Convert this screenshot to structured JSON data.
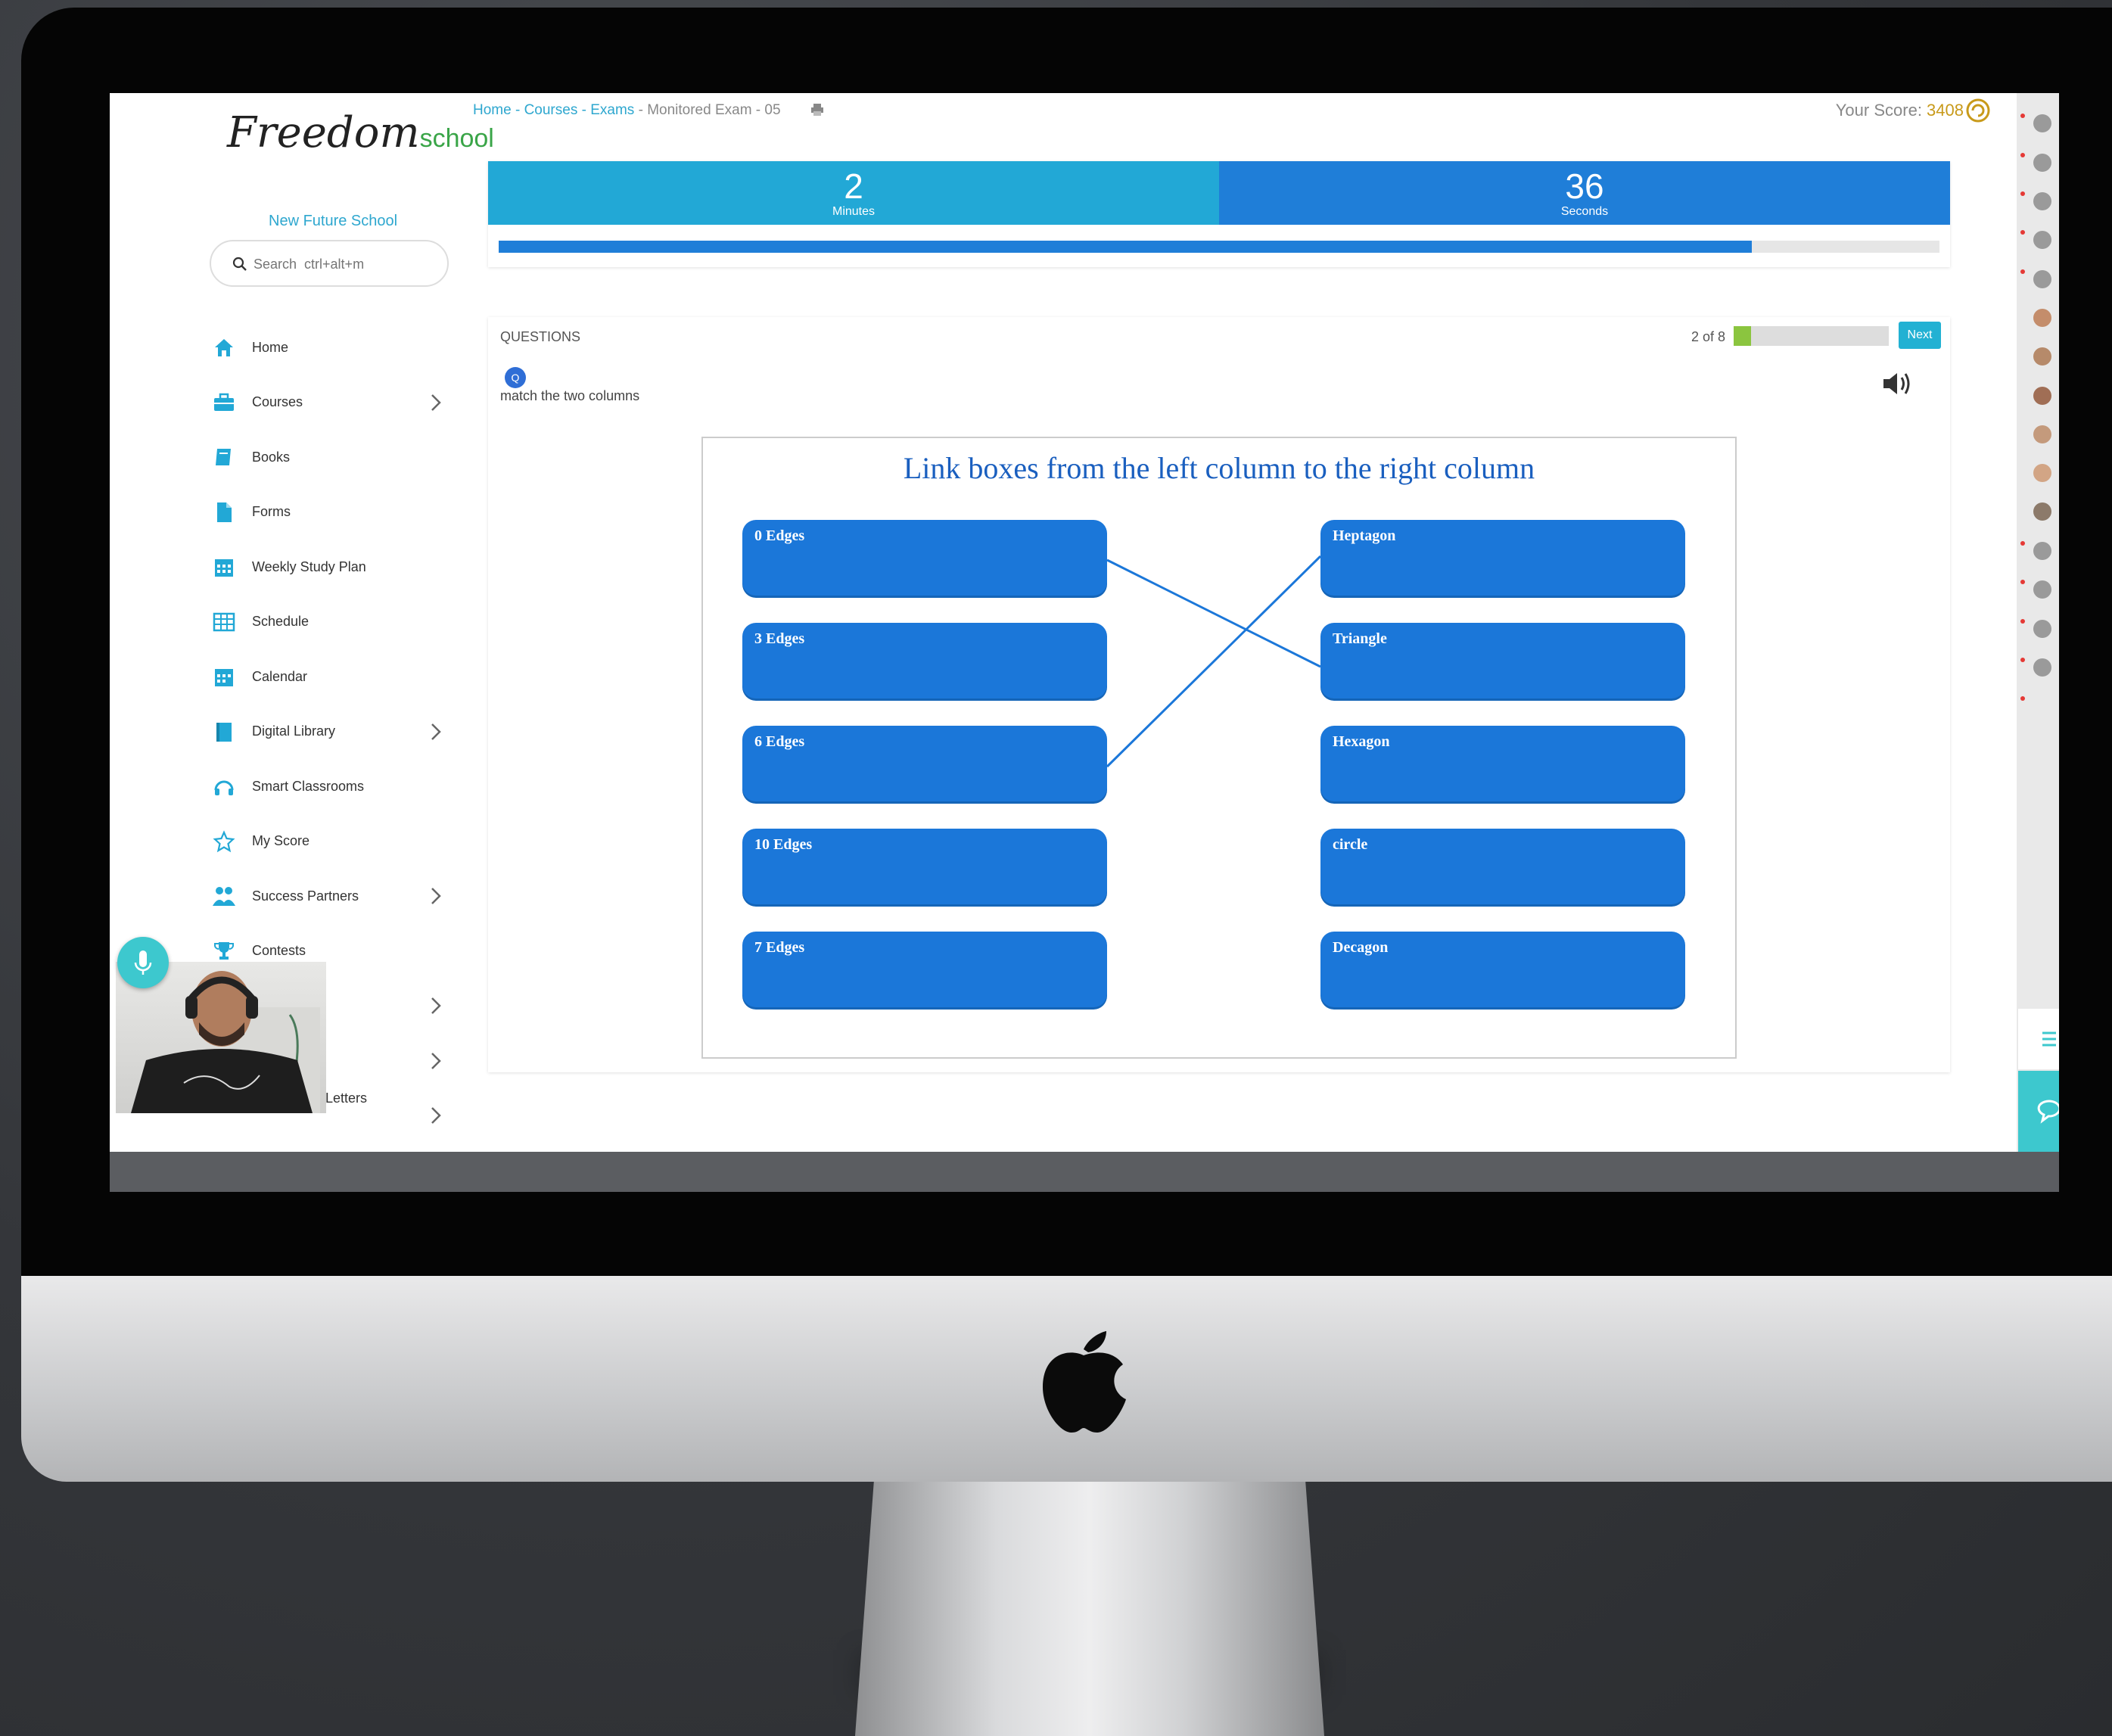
{
  "brand": {
    "logo_script": "Freedom",
    "logo_suffix": "school",
    "school_name": "New Future School"
  },
  "search": {
    "placeholder": "Search  ctrl+alt+m"
  },
  "sidebar": {
    "items": [
      {
        "label": "Home",
        "icon": "home-icon",
        "has_submenu": false
      },
      {
        "label": "Courses",
        "icon": "briefcase-icon",
        "has_submenu": true
      },
      {
        "label": "Books",
        "icon": "book-icon",
        "has_submenu": false
      },
      {
        "label": "Forms",
        "icon": "document-icon",
        "has_submenu": false
      },
      {
        "label": "Weekly Study Plan",
        "icon": "calendar-icon",
        "has_submenu": false
      },
      {
        "label": "Schedule",
        "icon": "table-icon",
        "has_submenu": false
      },
      {
        "label": "Calendar",
        "icon": "calendar-icon",
        "has_submenu": false
      },
      {
        "label": "Digital Library",
        "icon": "library-icon",
        "has_submenu": true
      },
      {
        "label": "Smart Classrooms",
        "icon": "headphones-icon",
        "has_submenu": false
      },
      {
        "label": "My Score",
        "icon": "star-icon",
        "has_submenu": false
      },
      {
        "label": "Success Partners",
        "icon": "partners-icon",
        "has_submenu": true
      },
      {
        "label": "Contests",
        "icon": "trophy-icon",
        "has_submenu": false
      }
    ],
    "letters_label": "Letters"
  },
  "breadcrumb": {
    "home": "Home",
    "courses": "Courses",
    "exams": "Exams",
    "current": "Monitored Exam - 05",
    "sep": " - "
  },
  "score": {
    "label": "Your Score: ",
    "value": "3408"
  },
  "timer": {
    "minutes": "2",
    "minutes_label": "Minutes",
    "seconds": "36",
    "seconds_label": "Seconds",
    "progress_fraction": 0.87
  },
  "question": {
    "header": "QUESTIONS",
    "counter": "2 of 8",
    "progress_fraction": 0.11,
    "next_label": "Next",
    "badge": "Q",
    "text": "match the two columns",
    "instruction": "Link boxes from the left column to the right column",
    "left": [
      "0 Edges",
      "3 Edges",
      "6 Edges",
      "10 Edges",
      "7 Edges"
    ],
    "right": [
      "Heptagon",
      "Triangle",
      "Hexagon",
      "circle",
      "Decagon"
    ],
    "links": [
      {
        "from": "0 Edges",
        "to": "Triangle"
      },
      {
        "from": "6 Edges",
        "to": "Heptagon"
      }
    ]
  },
  "colors": {
    "accent": "#22a8d6",
    "box_blue": "#1b77d9",
    "score_gold": "#c89a1a",
    "progress_green": "#8bc53f"
  }
}
